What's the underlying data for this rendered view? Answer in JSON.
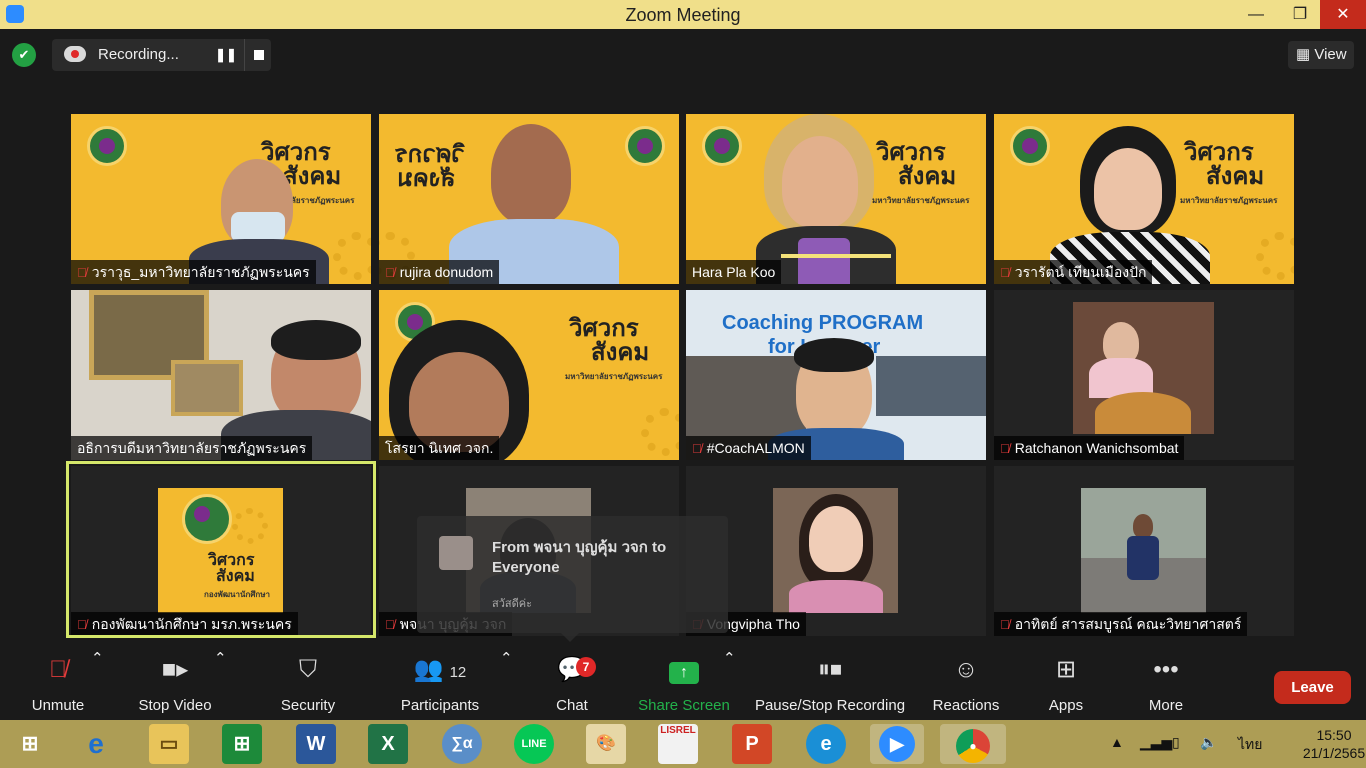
{
  "window": {
    "title": "Zoom Meeting",
    "minimize": "—",
    "maximize": "❐",
    "close": "✕"
  },
  "recording": {
    "label": "Recording...",
    "pause_icon": "❚❚"
  },
  "view_button": {
    "label": "View",
    "icon": "grid-icon"
  },
  "banner": {
    "title_line1": "วิศวกร",
    "title_line2": "สังคม",
    "subtitle": "มหาวิทยาลัยราชภัฏพระนคร"
  },
  "participants": [
    {
      "name": "วราวุธ_มหาวิทยาลัยราชภัฏพระนคร",
      "muted": true
    },
    {
      "name": "rujira donudom",
      "muted": true
    },
    {
      "name": "Hara Pla Koo",
      "muted": false,
      "speaking": true
    },
    {
      "name": "วรารัตน์ เทียนเมืองปัก",
      "muted": true
    },
    {
      "name": "อธิการบดีมหาวิทยาลัยราชภัฏพระนคร",
      "muted": false
    },
    {
      "name": "โสรยา นิเทศ วจก.",
      "muted": false
    },
    {
      "name": "#CoachALMON",
      "muted": true
    },
    {
      "name": "Ratchanon Wanichsombat",
      "muted": true
    },
    {
      "name": "กองพัฒนานักศึกษา มรภ.พระนคร",
      "muted": true,
      "pinned": true
    },
    {
      "name": "พจนา บุญคุ้ม วจก",
      "muted": true
    },
    {
      "name": "Vongvipha Tho",
      "muted": true
    },
    {
      "name": "อาทิตย์ สารสมบูรณ์ คณะวิทยาศาสตร์",
      "muted": true
    }
  ],
  "coaching": {
    "line1": "Coaching PROGRAM",
    "line2": "for Lecturer"
  },
  "student_affairs_tile": {
    "title_line1": "วิศวกร",
    "title_line2": "สังคม",
    "subtitle": "กองพัฒนานักศึกษา"
  },
  "chat_popup": {
    "from": "From พจนา บุญคุ้ม วจก to Everyone",
    "preview": "สวัสดีค่ะ"
  },
  "toolbar": {
    "unmute": "Unmute",
    "stop_video": "Stop Video",
    "security": "Security",
    "participants": "Participants",
    "participants_count": "12",
    "chat": "Chat",
    "chat_badge": "7",
    "share_screen": "Share Screen",
    "pause_stop_recording": "Pause/Stop Recording",
    "reactions": "Reactions",
    "apps": "Apps",
    "more": "More",
    "leave": "Leave"
  },
  "taskbar": {
    "apps": [
      "start-icon",
      "internet-explorer-icon",
      "file-explorer-icon",
      "store-icon",
      "word-icon",
      "excel-icon",
      "math-input-icon",
      "line-icon",
      "paint-icon",
      "lisrel-icon",
      "powerpoint-icon",
      "edge-icon",
      "zoom-icon",
      "chrome-icon"
    ],
    "lisrel_label": "LISREL",
    "language": "ไทย",
    "time": "15:50",
    "date": "21/1/2565"
  },
  "colors": {
    "accent": "#2d8cff",
    "leave": "#c42b1c",
    "banner": "#f3ba2f",
    "active_speaker": "#d5e76a",
    "share_green": "#23b24b"
  }
}
